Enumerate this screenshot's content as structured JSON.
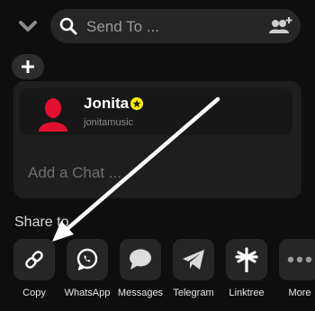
{
  "search": {
    "placeholder": "Send To ..."
  },
  "contact": {
    "name": "Jonita",
    "username": "jonitamusic"
  },
  "chat": {
    "placeholder": "Add a Chat ..."
  },
  "share": {
    "title": "Share to",
    "items": [
      {
        "label": "Copy",
        "icon": "link-icon"
      },
      {
        "label": "WhatsApp",
        "icon": "whatsapp-icon"
      },
      {
        "label": "Messages",
        "icon": "message-bubble-icon"
      },
      {
        "label": "Telegram",
        "icon": "telegram-icon"
      },
      {
        "label": "Linktree",
        "icon": "linktree-icon"
      },
      {
        "label": "More",
        "icon": "more-dots-icon"
      }
    ]
  },
  "colors": {
    "background": "#0e0e0e",
    "tile": "#262626",
    "avatar": "#e0102e",
    "badge": "#fff200"
  }
}
